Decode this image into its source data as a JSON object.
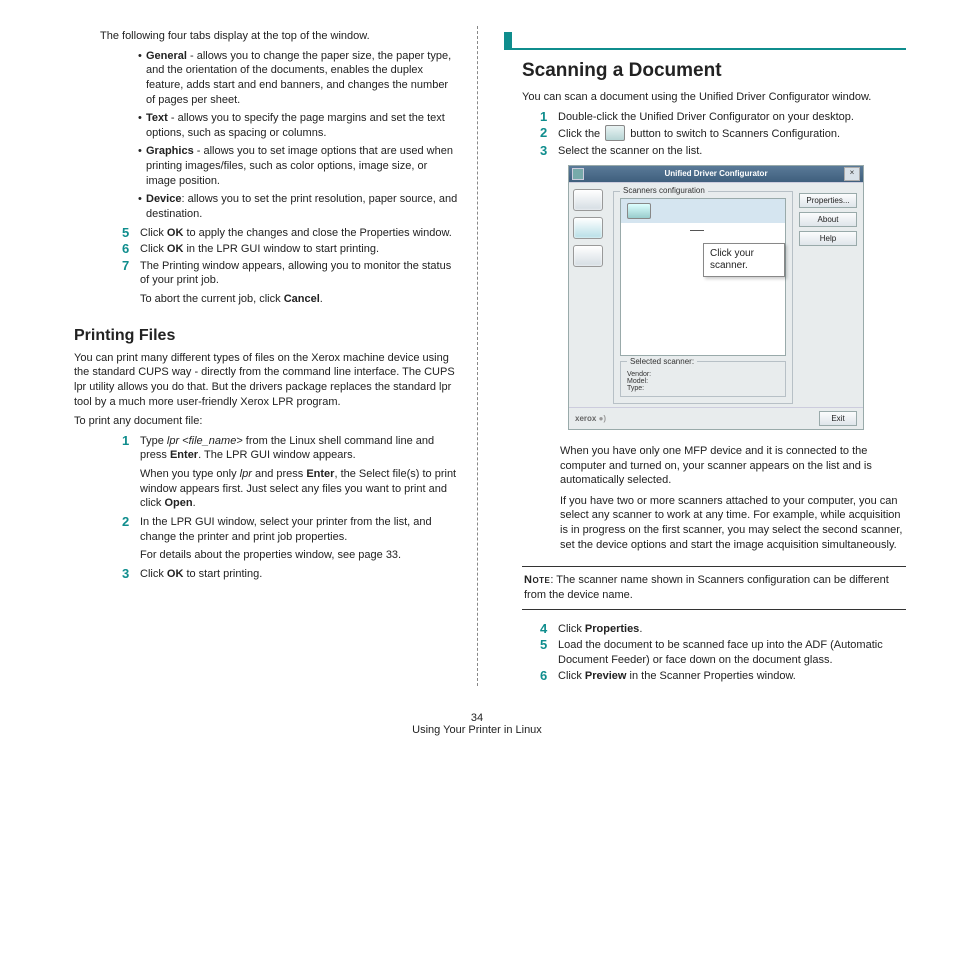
{
  "page_number": "34",
  "chapter_footer": "Using Your Printer in Linux",
  "left": {
    "intro_tabs": "The following four tabs display at the top of the window.",
    "bullets": [
      {
        "b": "General",
        "t": " - allows you to change the paper size, the paper type, and the orientation of the documents, enables the duplex feature, adds start and end banners, and changes the number of pages per sheet."
      },
      {
        "b": "Text",
        "t": " - allows you to specify the page margins and set the text options, such as spacing or columns."
      },
      {
        "b": "Graphics",
        "t": " - allows you to set image options that are used when printing images/files, such as color options, image size, or image position."
      },
      {
        "b": "Device",
        "t": ": allows you to set the print resolution, paper source, and destination."
      }
    ],
    "step5_a": "Click ",
    "step5_b": "OK",
    "step5_c": " to apply the changes and close the Properties window.",
    "step6_a": "Click ",
    "step6_b": "OK",
    "step6_c": " in the LPR GUI window to start printing.",
    "step7_a": "The Printing window appears, allowing you to monitor the status of your print job.",
    "step7_sub_a": "To abort the current job, click ",
    "step7_sub_b": "Cancel",
    "step7_sub_c": ".",
    "h2": "Printing Files",
    "pf_p1": "You can print many different types of files on the Xerox machine device using the standard CUPS way - directly from the command line interface. The CUPS lpr utility allows you do that. But the drivers package replaces the standard lpr tool by a much more user-friendly Xerox LPR program.",
    "pf_lead": "To print any document file:",
    "pf1_a": "Type ",
    "pf1_cmd": "lpr <file_name>",
    "pf1_b": " from the Linux shell command line and press ",
    "pf1_c": "Enter",
    "pf1_d": ". The LPR GUI window appears.",
    "pf1_sub_a": "When you type only ",
    "pf1_sub_cmd": "lpr",
    "pf1_sub_b": " and press ",
    "pf1_sub_c": "Enter",
    "pf1_sub_d": ", the Select file(s) to print window appears first. Just select any files you want to print and click ",
    "pf1_sub_e": "Open",
    "pf1_sub_f": ".",
    "pf2": "In the LPR GUI window, select your printer from the list, and change the printer and print job properties.",
    "pf2_sub": "For details about the properties window, see page 33.",
    "pf3_a": "Click ",
    "pf3_b": "OK",
    "pf3_c": " to start printing."
  },
  "right": {
    "h1": "Scanning a Document",
    "p1": "You can scan a document using the Unified Driver Configurator window.",
    "s1": "Double-click the Unified Driver Configurator on your desktop.",
    "s2_a": "Click the ",
    "s2_b": " button to switch to Scanners Configuration.",
    "s3": "Select the scanner on the list.",
    "ss": {
      "title": "Unified Driver Configurator",
      "group": "Scanners configuration",
      "callout": "Click your scanner.",
      "selgroup": "Selected scanner:",
      "vendor": "Vendor:",
      "model": "Model:",
      "type": "Type:",
      "btn_props": "Properties...",
      "btn_about": "About",
      "btn_help": "Help",
      "logo": "xerox",
      "btn_exit": "Exit"
    },
    "after1": "When you have only one MFP device and it is connected to the computer and turned on, your scanner appears on the list and is automatically selected.",
    "after2": "If you have two or more scanners attached to your computer, you can select any scanner to work at any time. For example, while acquisition is in progress on the first scanner, you may select the second scanner, set the device options and start the image acquisition simultaneously.",
    "note_a": "Note",
    "note_b": ": The scanner name shown in Scanners configuration can be different from the device name.",
    "s4_a": "Click ",
    "s4_b": "Properties",
    "s4_c": ".",
    "s5": "Load the document to be scanned face up into the ADF (Automatic Document Feeder) or face down on the document glass.",
    "s6_a": "Click ",
    "s6_b": "Preview",
    "s6_c": " in the Scanner Properties window."
  }
}
